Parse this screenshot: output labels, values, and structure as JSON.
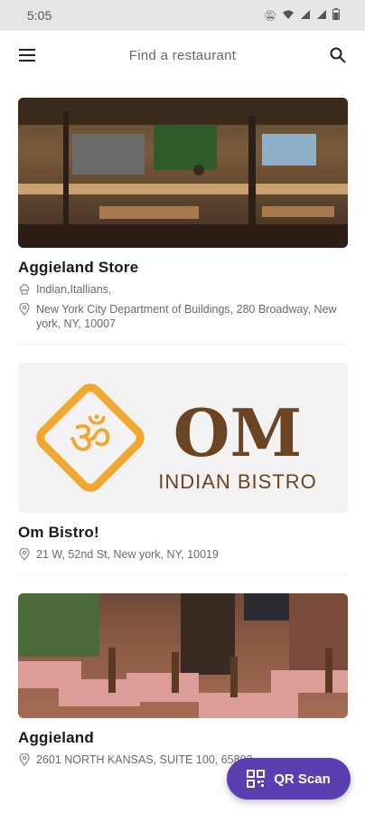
{
  "status_bar": {
    "time": "5:05",
    "icons": [
      "mute-icon",
      "wifi-icon",
      "signal-icon",
      "signal-icon",
      "battery-icon"
    ]
  },
  "header": {
    "menu_icon": "hamburger-menu-icon",
    "search_placeholder": "Find a restaurant",
    "search_icon": "search-icon"
  },
  "restaurants": [
    {
      "name": "Aggieland Store",
      "cuisine": "Indian,Itallians,",
      "address": "New York City Department of Buildings, 280 Broadway, New york, NY, 10007",
      "image": "restaurant-interior-photo"
    },
    {
      "name": "Om Bistro!",
      "address": "21 W, 52nd St, New york, NY, 10019",
      "image": "om-indian-bistro-logo",
      "logo_symbol": "ॐ",
      "logo_wordmark": "OM",
      "logo_tagline": "INDIAN BISTRO"
    },
    {
      "name": "Aggieland",
      "address": "2601 NORTH KANSAS, SUITE 100, 65803",
      "image": "patio-dining-photo"
    }
  ],
  "fab": {
    "label": "QR Scan",
    "icon": "qr-code-icon"
  },
  "colors": {
    "accent": "#5b3fb0",
    "logo_orange": "#f0a830",
    "logo_brown": "#6b4423"
  }
}
